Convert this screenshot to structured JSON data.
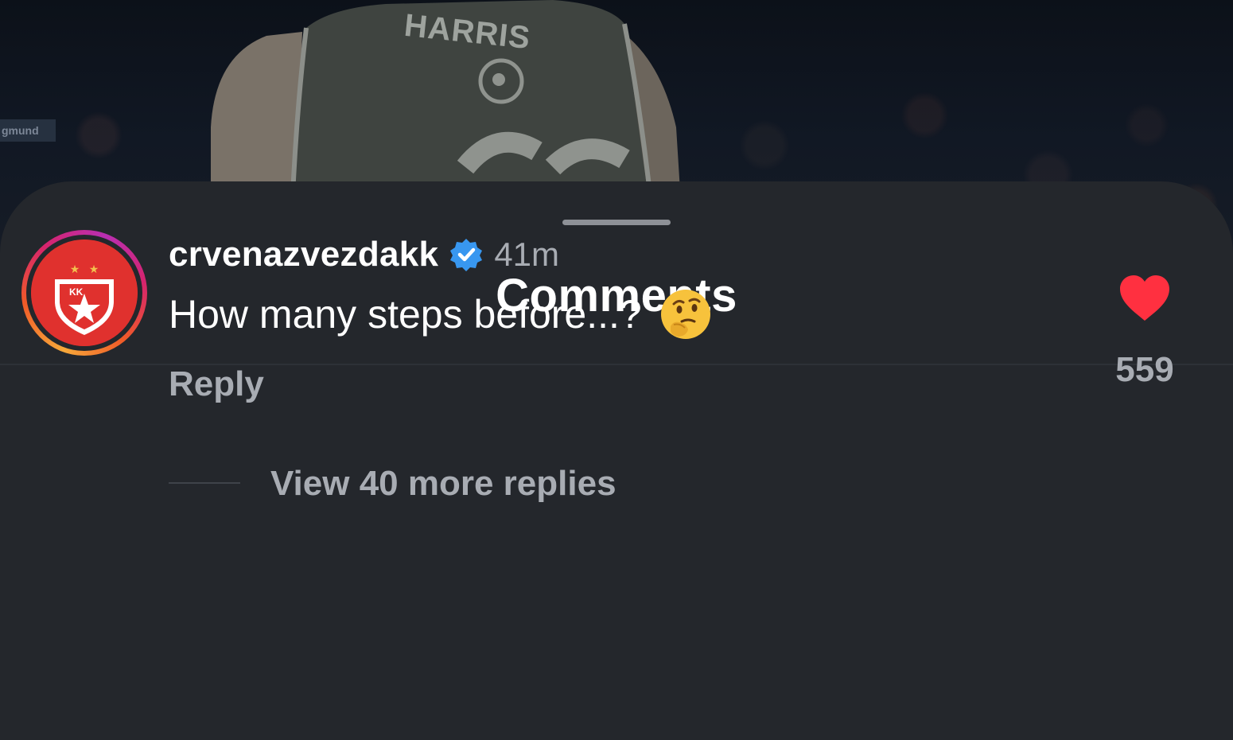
{
  "background": {
    "jersey_name": "HARRIS",
    "arena_sign": "gmund"
  },
  "sheet": {
    "title": "Comments"
  },
  "comment": {
    "username": "crvenazvezdakk",
    "verified_icon": "verified-badge-icon",
    "timestamp": "41m",
    "text": "How many steps before...?",
    "emoji": "thinking-face-emoji",
    "reply_label": "Reply",
    "likes": "559",
    "like_icon": "heart-icon",
    "liked": true,
    "avatar_text": "KK"
  },
  "replies": {
    "label": "View 40 more replies"
  },
  "colors": {
    "sheet_bg": "#24272c",
    "like_red": "#ff3040",
    "verified_blue": "#3897f0",
    "muted_text": "#a8acb3"
  }
}
